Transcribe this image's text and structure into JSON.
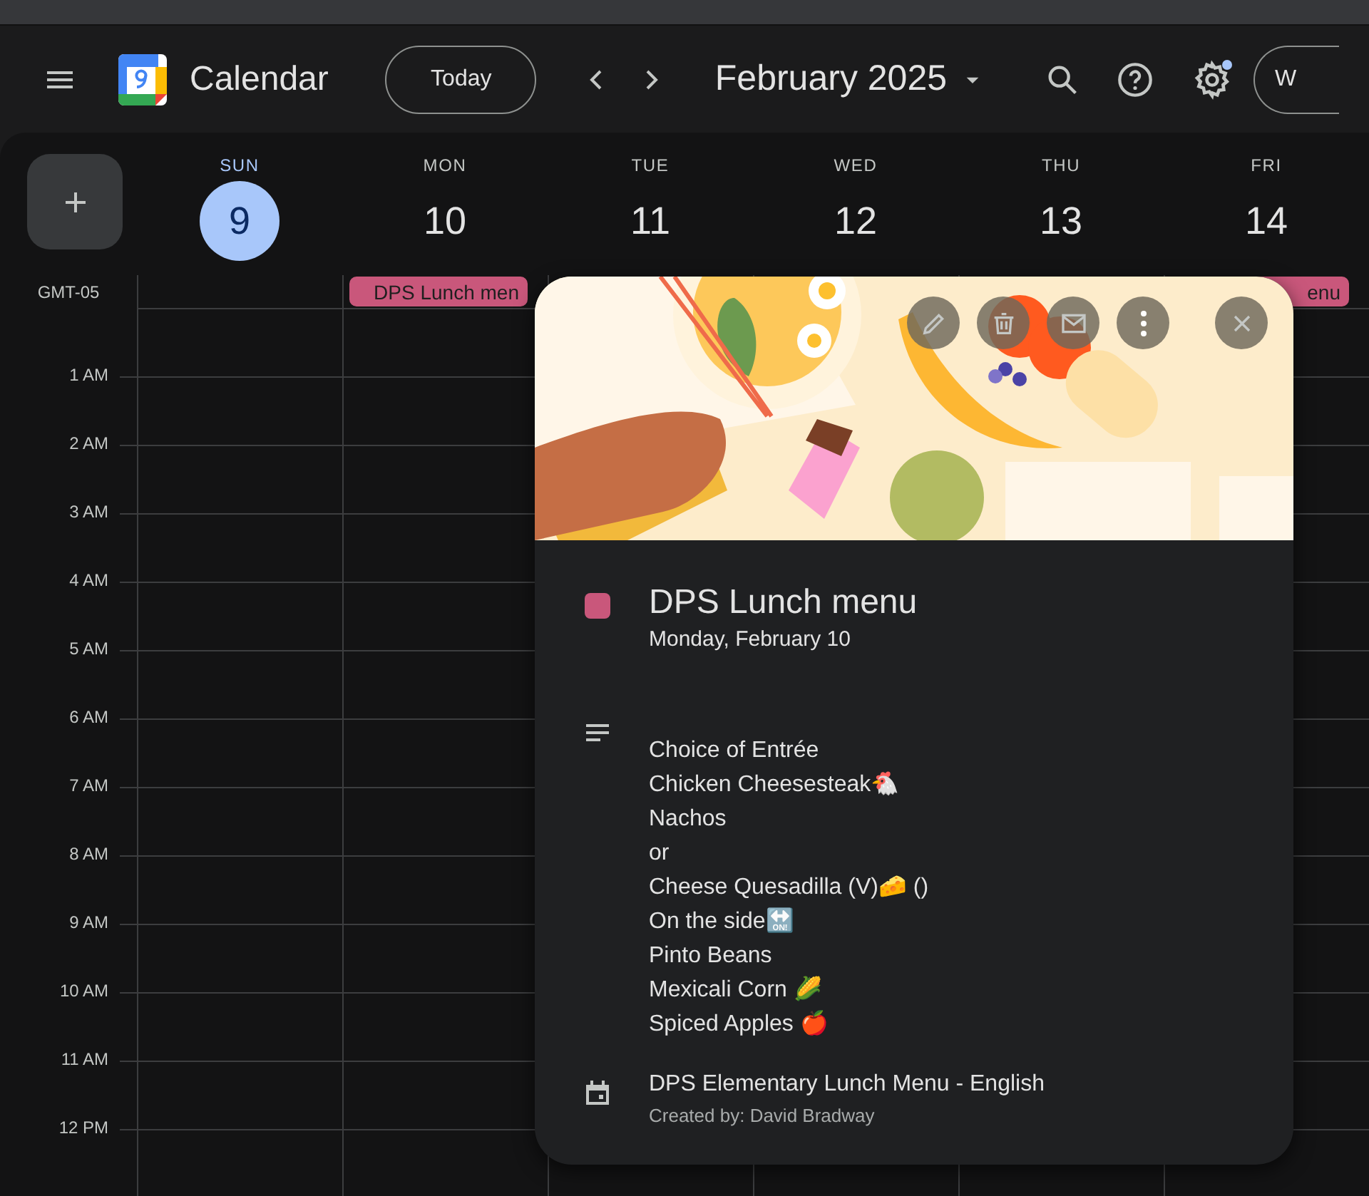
{
  "header": {
    "app_name": "Calendar",
    "today_button": "Today",
    "period": "February 2025",
    "partial_button": "W",
    "settings_badge": true
  },
  "timezone": "GMT-05",
  "days": [
    {
      "dow": "SUN",
      "date": "9",
      "selected": true
    },
    {
      "dow": "MON",
      "date": "10",
      "selected": false,
      "all_day_event": "DPS Lunch men"
    },
    {
      "dow": "TUE",
      "date": "11",
      "selected": false
    },
    {
      "dow": "WED",
      "date": "12",
      "selected": false
    },
    {
      "dow": "THU",
      "date": "13",
      "selected": false
    },
    {
      "dow": "FRI",
      "date": "14",
      "selected": false,
      "all_day_event": "enu"
    }
  ],
  "hours": [
    "1 AM",
    "2 AM",
    "3 AM",
    "4 AM",
    "5 AM",
    "6 AM",
    "7 AM",
    "8 AM",
    "9 AM",
    "10 AM",
    "11 AM",
    "12 PM"
  ],
  "event_popup": {
    "title": "DPS Lunch menu",
    "date": "Monday, February 10",
    "color": "#c9577b",
    "description_lines": [
      "Choice of Entrée",
      "Chicken Cheesesteak🐔",
      "Nachos",
      "or",
      "Cheese Quesadilla (V)🧀 ()",
      "On the side🔛",
      "Pinto Beans",
      "Mexicali Corn 🌽",
      "Spiced Apples 🍎"
    ],
    "calendar_name": "DPS Elementary Lunch Menu - English",
    "created_by": "Created by: David Bradway"
  }
}
